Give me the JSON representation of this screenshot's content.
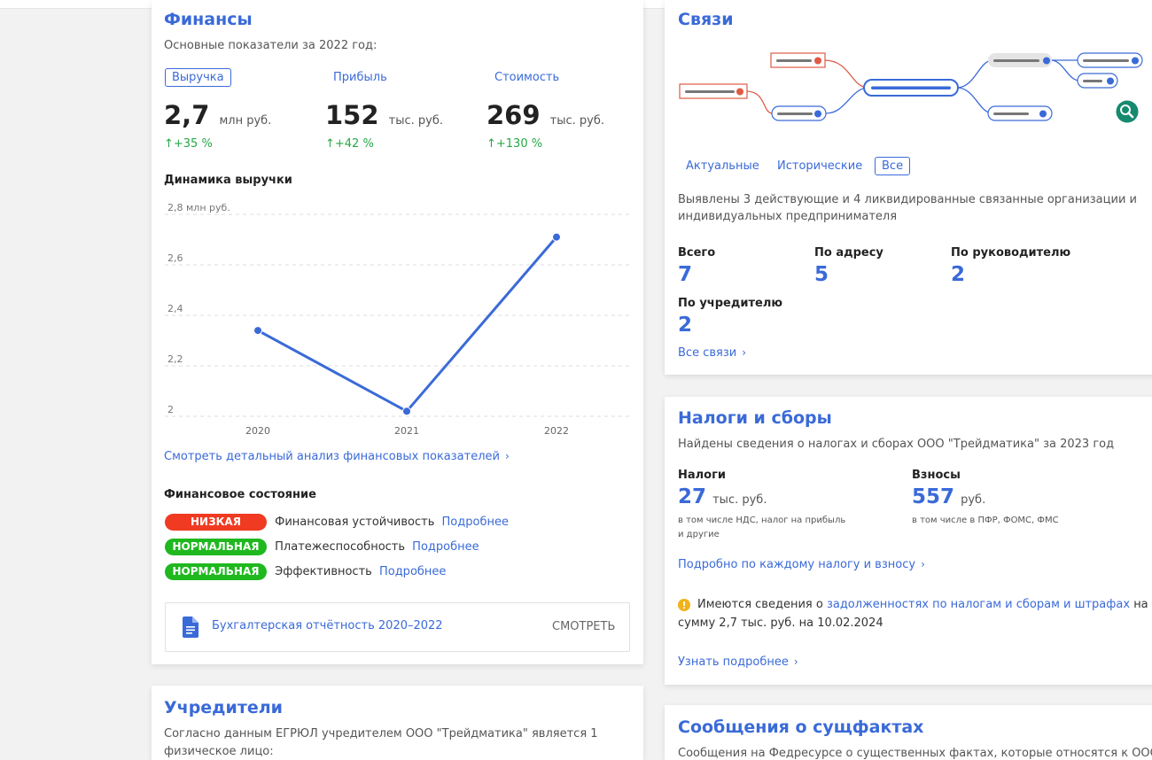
{
  "finance": {
    "title": "Финансы",
    "subtitle": "Основные показатели за 2022 год:",
    "tabs": [
      "Выручка",
      "Прибыль",
      "Стоимость"
    ],
    "metrics": [
      {
        "value": "2,7",
        "unit": "млн руб.",
        "growth": "↑+35 %"
      },
      {
        "value": "152",
        "unit": "тыс. руб.",
        "growth": "↑+42 %"
      },
      {
        "value": "269",
        "unit": "тыс. руб.",
        "growth": "↑+130 %"
      }
    ],
    "chart_title": "Динамика выручки",
    "detail_link": "Смотреть детальный анализ финансовых показателей",
    "state_title": "Финансовое состояние",
    "states": [
      {
        "badge": "НИЗКАЯ",
        "label": "Финансовая устойчивость",
        "link": "Подробнее",
        "color": "#f03a21"
      },
      {
        "badge": "НОРМАЛЬНАЯ",
        "label": "Платежеспособность",
        "link": "Подробнее",
        "color": "#1fb81f"
      },
      {
        "badge": "НОРМАЛЬНАЯ",
        "label": "Эффективность",
        "link": "Подробнее",
        "color": "#1fb81f"
      }
    ],
    "doc_label": "Бухгалтерская отчётность 2020–2022",
    "doc_action": "СМОТРЕТЬ"
  },
  "chart_data": {
    "type": "line",
    "categories": [
      "2020",
      "2021",
      "2022"
    ],
    "values": [
      2.34,
      2.02,
      2.71
    ],
    "yticks": [
      "2,8 млн руб.",
      "2,6",
      "2,4",
      "2,2",
      "2"
    ],
    "ylim": [
      2.0,
      2.8
    ],
    "grid": true,
    "color": "#3a6ad8"
  },
  "founders": {
    "title": "Учредители",
    "text_line1": "Согласно данным ЕГРЮЛ учредителем ООО \"Трейдматика\" является 1",
    "text_line2": "физическое лицо:"
  },
  "links": {
    "title": "Связи",
    "tabs": [
      "Актуальные",
      "Исторические",
      "Все"
    ],
    "description_line1": "Выявлены 3 действующие и 4 ликвидированные связанные организации и",
    "description_line2": "индивидуальных предпринимателя",
    "stats": [
      {
        "label": "Всего",
        "value": "7"
      },
      {
        "label": "По адресу",
        "value": "5"
      },
      {
        "label": "По руководителю",
        "value": "2"
      },
      {
        "label": "По учредителю",
        "value": "2"
      }
    ],
    "all_link": "Все связи",
    "colors": {
      "active": "#3a6ad8",
      "liquidated": "#e05a44",
      "line": "#888"
    }
  },
  "taxes": {
    "title": "Налоги и сборы",
    "subtitle": "Найдены сведения о налогах и сборах ООО \"Трейдматика\" за 2023 год",
    "taxes_label": "Налоги",
    "taxes_value": "27",
    "taxes_unit": "тыс. руб.",
    "taxes_note1": "в том числе НДС, налог на прибыль",
    "taxes_note2": "и другие",
    "contrib_label": "Взносы",
    "contrib_value": "557",
    "contrib_unit": "руб.",
    "contrib_note": "в том числе в ПФР, ФОМС, ФМС",
    "detail_link": "Подробно по каждому налогу и взносу",
    "warning_pre": "Имеются сведения о",
    "warning_link": "задолженностях по налогам и сборам и штрафах",
    "warning_post": "на",
    "warning_line2_pre": "сумму",
    "warning_amount": "2,7 тыс. руб.",
    "warning_date": "на 10.02.2024",
    "learn_more": "Узнать подробнее"
  },
  "facts": {
    "title": "Сообщения о сущфактах",
    "text": "Сообщения на Федресурсе о существенных фактах, которые относятся к ООО"
  }
}
